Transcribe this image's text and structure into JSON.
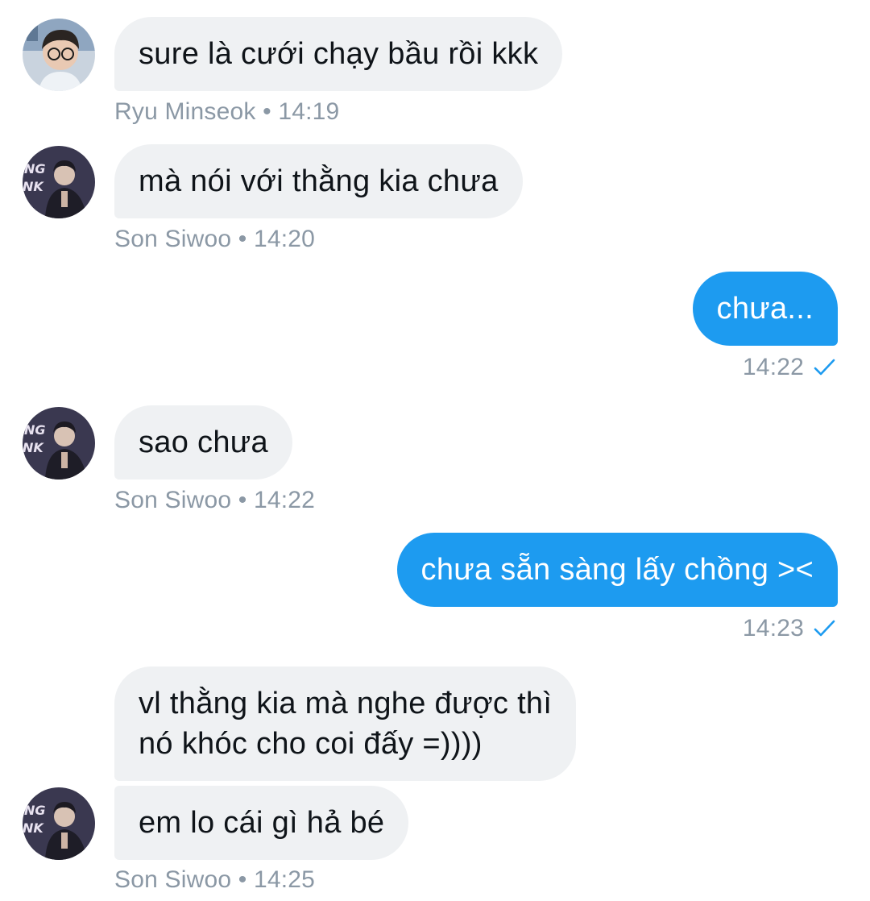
{
  "messages": [
    {
      "direction": "in",
      "sender": "Ryu Minseok",
      "time": "14:19",
      "text": "sure là cưới chạy bầu rồi kkk"
    },
    {
      "direction": "in",
      "sender": "Son Siwoo",
      "time": "14:20",
      "text": "mà nói với thằng kia chưa"
    },
    {
      "direction": "out",
      "time": "14:22",
      "text": "chưa...",
      "status_icon": "check-icon"
    },
    {
      "direction": "in",
      "sender": "Son Siwoo",
      "time": "14:22",
      "text": "sao chưa"
    },
    {
      "direction": "out",
      "time": "14:23",
      "text": "chưa sẵn sàng lấy chồng ><",
      "status_icon": "check-icon"
    },
    {
      "direction": "in",
      "sender": "Son Siwoo",
      "text_lines": [
        "vl thằng kia mà nghe được thì",
        "nó khóc cho coi đấy =))))"
      ]
    },
    {
      "direction": "in",
      "sender": "Son Siwoo",
      "time": "14:25",
      "text": "em lo cái gì hả bé"
    }
  ],
  "meta": {
    "m0": "Ryu Minseok • 14:19",
    "m1": "Son Siwoo • 14:20",
    "m3": "Son Siwoo • 14:22",
    "m6": "Son Siwoo • 14:25"
  },
  "colors": {
    "incoming_bubble": "#eff1f3",
    "outgoing_bubble": "#1d9bf0",
    "meta_text": "#8b98a5",
    "check": "#1d9bf0"
  }
}
